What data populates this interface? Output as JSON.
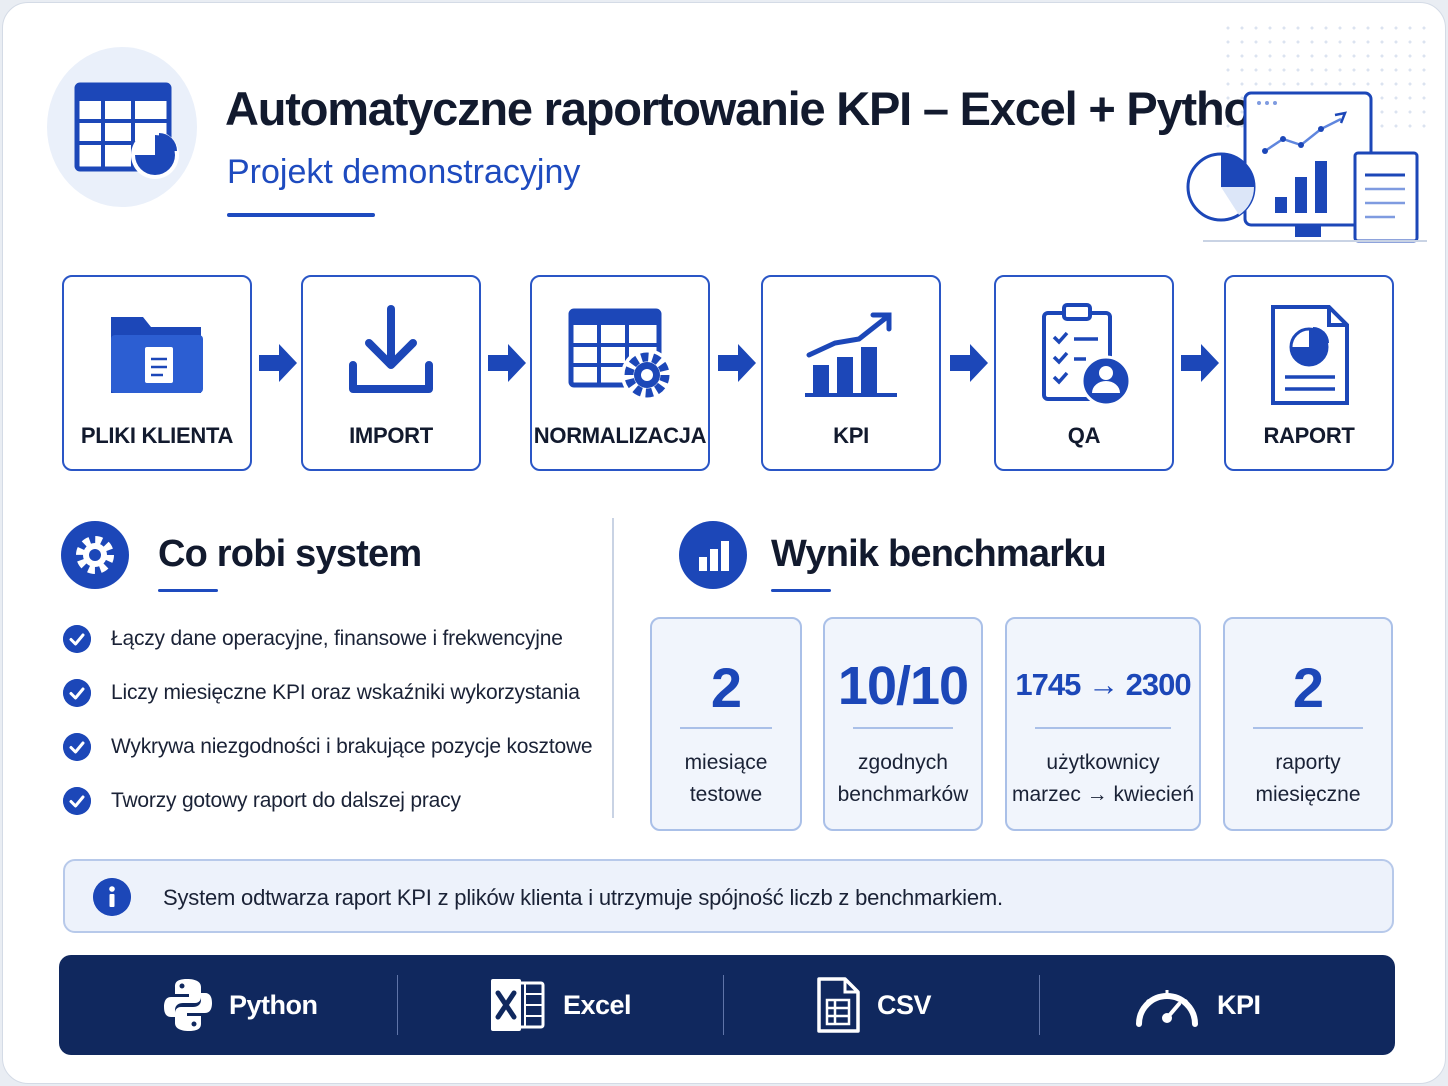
{
  "header": {
    "title": "Automatyczne raportowanie KPI – Excel + Python",
    "subtitle": "Projekt demonstracyjny",
    "logo_icon": "spreadsheet-pie-icon",
    "illustration_icon": "dashboard-charts-illustration"
  },
  "colors": {
    "primary": "#1c47b8",
    "navy": "#10285e",
    "border": "#2a56c6"
  },
  "pipeline": [
    {
      "label": "PLIKI KLIENTA",
      "icon": "folder-document-icon"
    },
    {
      "label": "IMPORT",
      "icon": "download-icon"
    },
    {
      "label": "NORMALIZACJA",
      "icon": "table-gear-icon"
    },
    {
      "label": "KPI",
      "icon": "bar-chart-trend-icon"
    },
    {
      "label": "QA",
      "icon": "checklist-user-icon"
    },
    {
      "label": "RAPORT",
      "icon": "report-pie-icon"
    }
  ],
  "features": {
    "title": "Co robi system",
    "items": [
      "Łączy dane operacyjne, finansowe i frekwencyjne",
      "Liczy miesięczne KPI oraz wskaźniki wykorzystania",
      "Wykrywa niezgodności i brakujące pozycje kosztowe",
      "Tworzy gotowy raport do dalszej pracy"
    ]
  },
  "benchmark": {
    "title": "Wynik benchmarku",
    "cards": [
      {
        "value": "2",
        "line1": "miesiące",
        "line2": "testowe"
      },
      {
        "value": "10/10",
        "line1": "zgodnych",
        "line2": "benchmarków"
      },
      {
        "value": "1745 → 2300",
        "line1": "użytkownicy",
        "line2": "marzec → kwiecień"
      },
      {
        "value": "2",
        "line1": "raporty",
        "line2": "miesięczne"
      }
    ]
  },
  "note": {
    "text": "System odtwarza raport KPI z plików klienta i utrzymuje spójność liczb z benchmarkiem."
  },
  "tech": [
    {
      "label": "Python",
      "icon": "python-icon"
    },
    {
      "label": "Excel",
      "icon": "excel-icon"
    },
    {
      "label": "CSV",
      "icon": "csv-document-icon"
    },
    {
      "label": "KPI",
      "icon": "gauge-icon"
    }
  ]
}
